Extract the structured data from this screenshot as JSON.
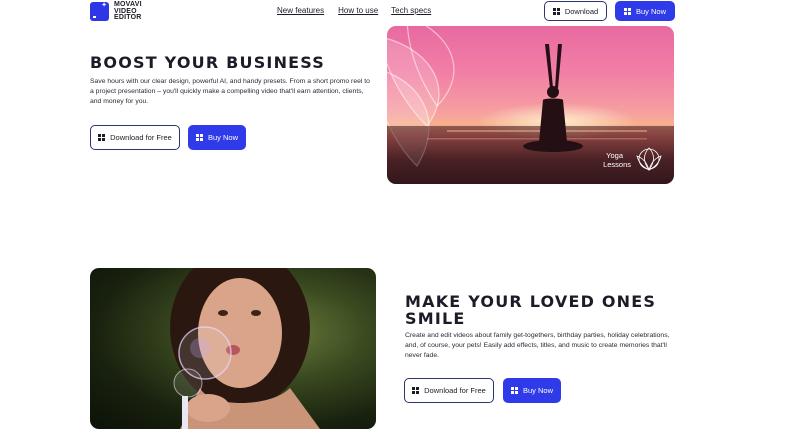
{
  "header": {
    "logo_line1": "MOVAVI",
    "logo_line2": "VIDEO",
    "logo_line3": "EDITOR",
    "nav": [
      "New features",
      "How to use",
      "Tech specs"
    ],
    "download_label": "Download",
    "buy_label": "Buy Now"
  },
  "section1": {
    "title": "BOOST YOUR BUSINESS",
    "body": "Save hours with our clear design, powerful AI, and handy presets. From a short promo reel to a project presentation – you'll quickly make a compelling video that'll earn attention, clients, and money for you.",
    "download_label": "Download for Free",
    "buy_label": "Buy Now",
    "image_caption_line1": "Yoga",
    "image_caption_line2": "Lessons"
  },
  "section2": {
    "title_line1": "MAKE YOUR LOVED ONES",
    "title_line2": "SMILE",
    "body": "Create and edit videos about family get-togethers, birthday parties, holiday celebrations, and, of course, your pets! Easily add effects, titles, and music to create memories that'll never fade.",
    "download_label": "Download for Free",
    "buy_label": "Buy Now"
  },
  "colors": {
    "accent": "#2f3be8",
    "outline": "#2c3570",
    "text": "#1c1c28"
  },
  "icons": {
    "logo": "movavi-logo-icon",
    "windows": "windows-icon",
    "lotus": "lotus-icon"
  }
}
